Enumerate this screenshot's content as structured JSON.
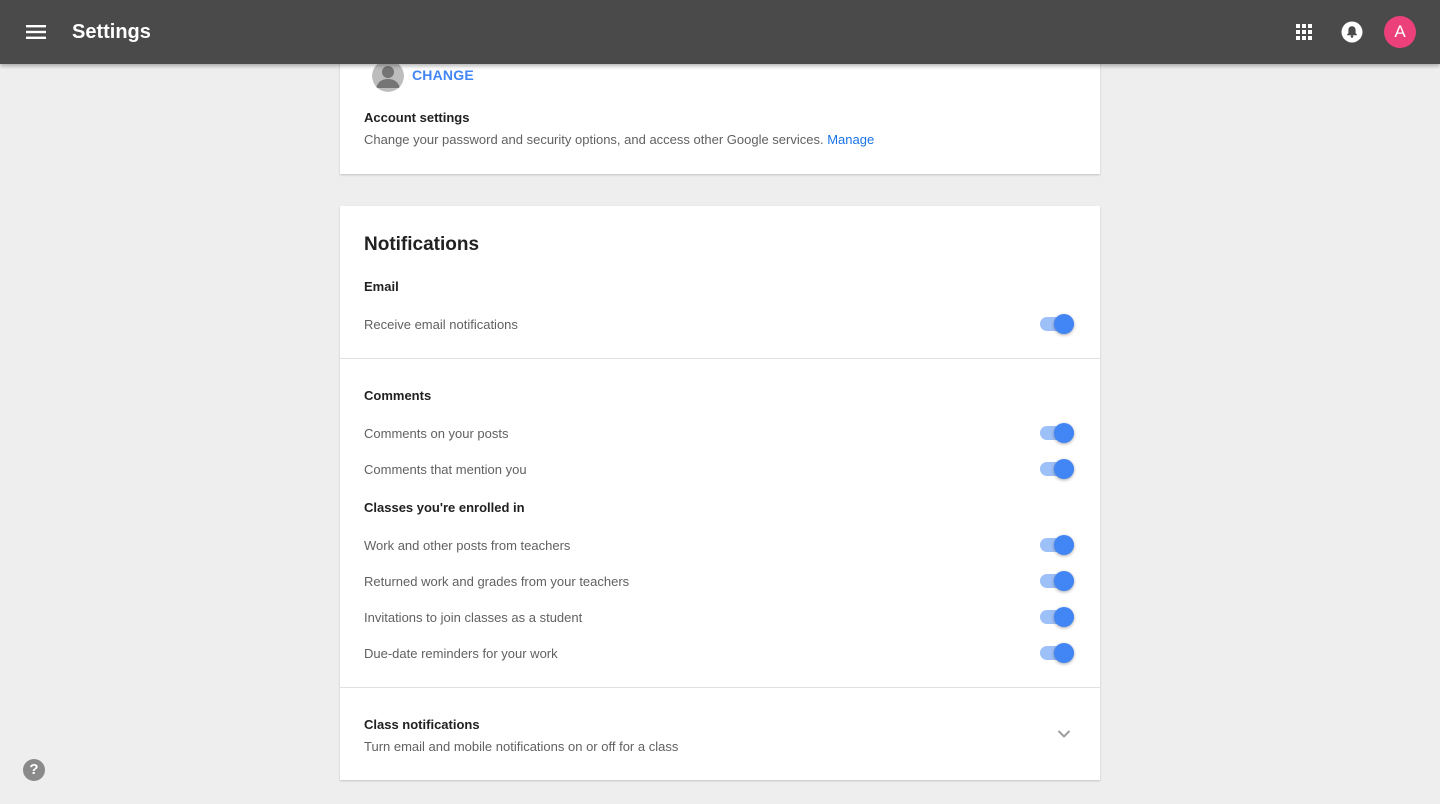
{
  "header": {
    "title": "Settings",
    "menu_icon": "menu-icon",
    "apps_icon": "apps-grid-icon",
    "notifications_icon": "bell-icon",
    "avatar_letter": "A",
    "avatar_color": "#ec407a"
  },
  "account": {
    "photo_icon": "account-circle-icon",
    "change_label": "CHANGE",
    "settings_label": "Account settings",
    "settings_desc": "Change your password and security options, and access other Google services.",
    "manage_label": "Manage"
  },
  "notifications": {
    "title": "Notifications",
    "email": {
      "heading": "Email",
      "items": [
        {
          "label": "Receive email notifications",
          "on": true
        }
      ]
    },
    "comments": {
      "heading": "Comments",
      "items": [
        {
          "label": "Comments on your posts",
          "on": true
        },
        {
          "label": "Comments that mention you",
          "on": true
        }
      ]
    },
    "enrolled": {
      "heading": "Classes you're enrolled in",
      "items": [
        {
          "label": "Work and other posts from teachers",
          "on": true
        },
        {
          "label": "Returned work and grades from your teachers",
          "on": true
        },
        {
          "label": "Invitations to join classes as a student",
          "on": true
        },
        {
          "label": "Due-date reminders for your work",
          "on": true
        }
      ]
    },
    "class_notifications": {
      "heading": "Class notifications",
      "desc": "Turn email and mobile notifications on or off for a class",
      "expand_icon": "chevron-down-icon"
    }
  },
  "help": {
    "label": "?",
    "icon": "help-icon"
  },
  "colors": {
    "topbar": "#4a4a4a",
    "accent": "#4285f4",
    "toggle_track": "#9ec0f8",
    "background": "#eeeeee"
  }
}
